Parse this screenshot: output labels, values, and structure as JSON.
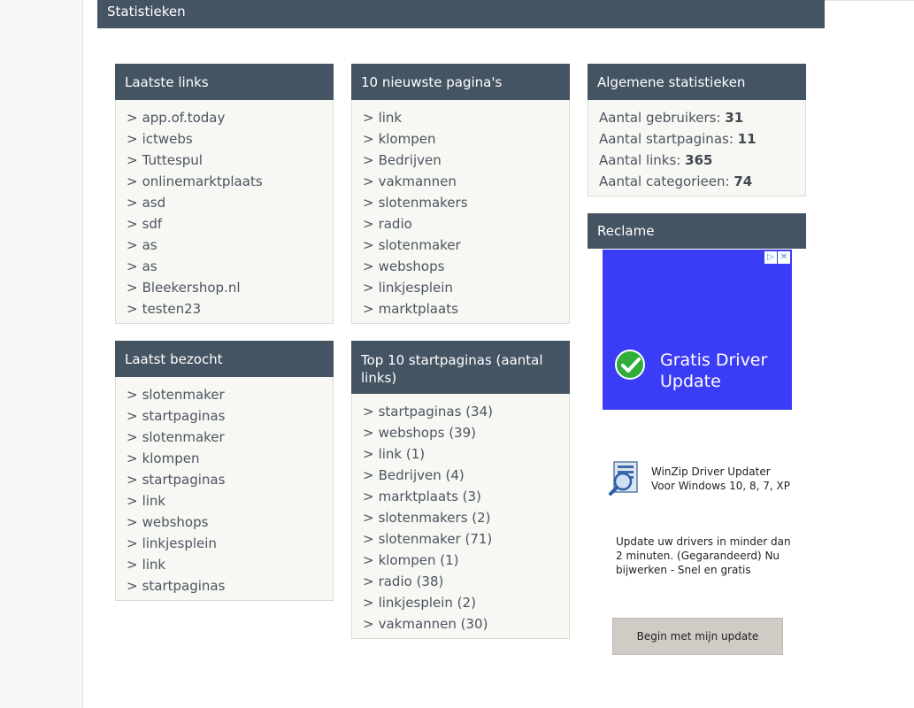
{
  "header": {
    "title": "Statistieken"
  },
  "laatste_links": {
    "title": "Laatste links",
    "items": [
      "app.of.today",
      "ictwebs",
      "Tuttespul",
      "onlinemarktplaats",
      "asd",
      "sdf",
      "as",
      "as",
      "Bleekershop.nl",
      "testen23"
    ]
  },
  "nieuwste_paginas": {
    "title": "10 nieuwste pagina's",
    "items": [
      "link",
      "klompen",
      "Bedrijven",
      "vakmannen",
      "slotenmakers",
      "radio",
      "slotenmaker",
      "webshops",
      "linkjesplein",
      "marktplaats"
    ]
  },
  "algemene_statistieken": {
    "title": "Algemene statistieken",
    "rows": [
      {
        "label": "Aantal gebruikers:",
        "value": "31"
      },
      {
        "label": "Aantal startpaginas:",
        "value": "11"
      },
      {
        "label": "Aantal links:",
        "value": "365"
      },
      {
        "label": "Aantal categorieen:",
        "value": "74"
      }
    ]
  },
  "laatst_bezocht": {
    "title": "Laatst bezocht",
    "items": [
      "slotenmaker",
      "startpaginas",
      "slotenmaker",
      "klompen",
      "startpaginas",
      "link",
      "webshops",
      "linkjesplein",
      "link",
      "startpaginas"
    ]
  },
  "top10": {
    "title": "Top 10 startpaginas (aantal links)",
    "items": [
      "startpaginas (34)",
      "webshops (39)",
      "link (1)",
      "Bedrijven (4)",
      "marktplaats (3)",
      "slotenmakers (2)",
      "slotenmaker (71)",
      "klompen (1)",
      "radio (38)",
      "linkjesplein (2)",
      "vakmannen (30)"
    ]
  },
  "reclame": {
    "title": "Reclame",
    "ad_title": "Gratis Driver Update",
    "ad_marks": [
      "▷",
      "✕"
    ],
    "ad2_title_line1": "WinZip Driver Updater",
    "ad2_title_line2": "Voor Windows 10, 8, 7, XP",
    "ad2_description": "Update uw drivers in minder dan 2 minuten.  (Gegarandeerd) Nu bijwerken - Snel en gratis",
    "ad2_button": "Begin met mijn update"
  },
  "list_prefix": ">",
  "colors": {
    "header_bg": "#455463",
    "panel_bg": "#f7f7f3",
    "ad_blue": "#3b3cf5"
  }
}
